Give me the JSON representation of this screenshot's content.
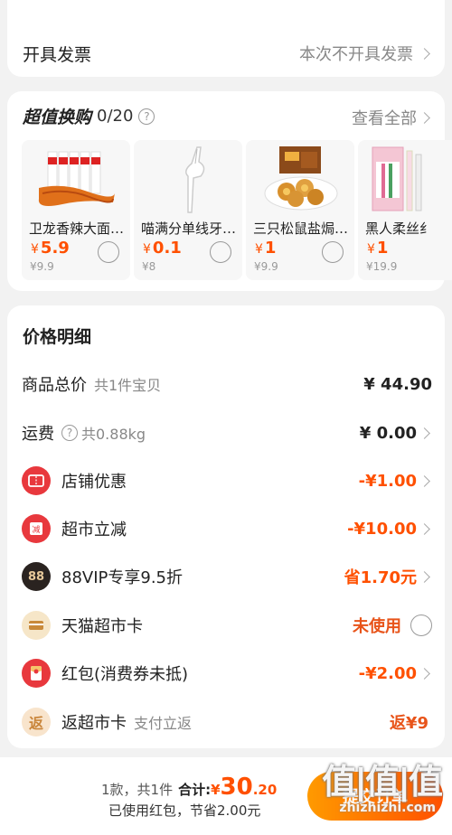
{
  "invoice": {
    "label": "开具发票",
    "value": "本次不开具发票"
  },
  "deals": {
    "title": "超值换购",
    "count": "0/20",
    "view_all": "查看全部",
    "products": [
      {
        "name": "卫龙香辣大面…",
        "price": "5.9",
        "currency": "¥",
        "original": "¥9.9"
      },
      {
        "name": "喵满分单线牙…",
        "price": "0.1",
        "currency": "¥",
        "original": "¥8"
      },
      {
        "name": "三只松鼠盐焗…",
        "price": "1",
        "currency": "¥",
        "original": "¥9.9"
      },
      {
        "name": "黑人柔丝纟",
        "price": "1",
        "currency": "¥",
        "original": "¥19.9"
      }
    ]
  },
  "details": {
    "title": "价格明细",
    "rows": [
      {
        "label": "商品总价",
        "sub": "共1件宝贝",
        "value": "¥ 44.90"
      },
      {
        "label": "运费",
        "sub": "共0.88kg",
        "value": "¥ 0.00"
      },
      {
        "label": "店铺优惠",
        "value": "-¥1.00"
      },
      {
        "label": "超市立减",
        "value": "-¥10.00"
      },
      {
        "label": "88VIP专享9.5折",
        "value": "省1.70元"
      },
      {
        "label": "天猫超市卡",
        "value": "未使用"
      },
      {
        "label": "红包(消费券未抵)",
        "value": "-¥2.00"
      },
      {
        "label": "返超市卡",
        "sub": "支付立返",
        "value": "返¥9"
      }
    ],
    "icons": {
      "coupon": "88",
      "cashback": "返"
    }
  },
  "bottom": {
    "count_text": "1款，共1件",
    "total_label": "合计:",
    "currency": "¥",
    "total_int": "30",
    "total_dec": ".20",
    "saved_text": "已使用红包，节省2.00元",
    "submit_label": "提交订单",
    "watermark_big": "值|值|值",
    "watermark_small": "zhizhizhi.com"
  },
  "colors": {
    "accent": "#ff5000",
    "red_icon": "#e8383d",
    "gold": "#d9a868"
  }
}
